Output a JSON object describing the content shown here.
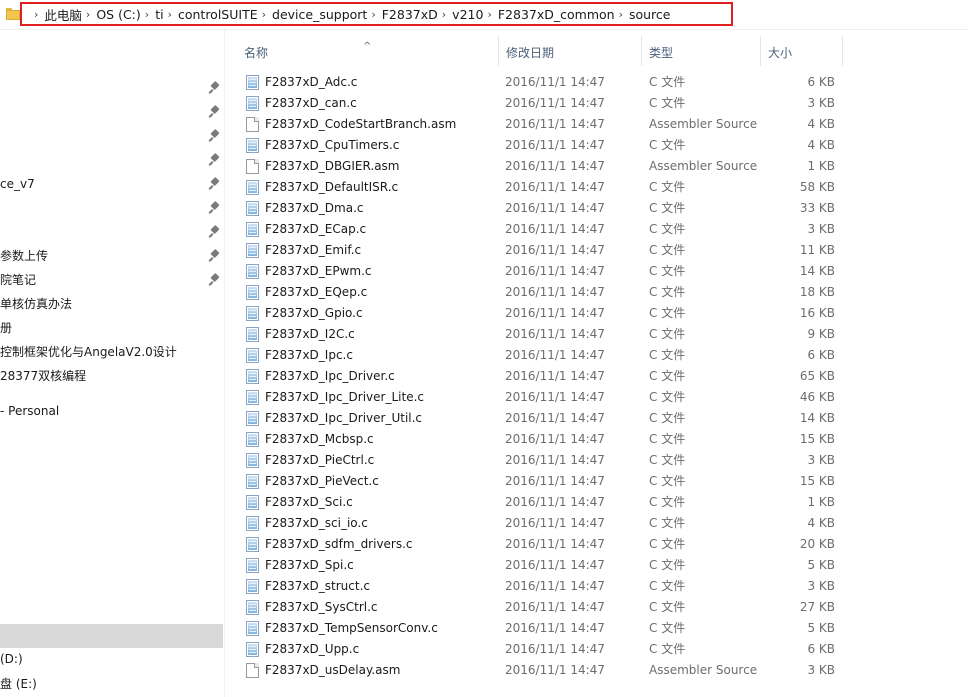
{
  "address": {
    "crumbs": [
      "此电脑",
      "OS (C:)",
      "ti",
      "controlSUITE",
      "device_support",
      "F2837xD",
      "v210",
      "F2837xD_common",
      "source"
    ],
    "separator": "›"
  },
  "nav": {
    "items": [
      {
        "label": "",
        "pinned": true
      },
      {
        "label": "",
        "pinned": true
      },
      {
        "label": "",
        "pinned": true
      },
      {
        "label": "",
        "pinned": true
      },
      {
        "label": "ce_v7",
        "pinned": true
      },
      {
        "label": "",
        "pinned": true
      },
      {
        "label": "",
        "pinned": true
      },
      {
        "label": "参数上传",
        "pinned": true
      },
      {
        "label": "院笔记",
        "pinned": true
      },
      {
        "label": "单核仿真办法",
        "pinned": false
      },
      {
        "label": "册",
        "pinned": false
      },
      {
        "label": "控制框架优化与AngelaV2.0设计",
        "pinned": false
      },
      {
        "label": "28377双核编程",
        "pinned": false
      }
    ],
    "onedrive": "- Personal",
    "drive_d": "(D:)",
    "drive_e": "盘 (E:)"
  },
  "columns": {
    "name": "名称",
    "date": "修改日期",
    "type": "类型",
    "size": "大小"
  },
  "files": [
    {
      "name": "F2837xD_Adc.c",
      "date": "2016/11/1 14:47",
      "type": "C 文件",
      "size": "6 KB",
      "icon": "c-file-icon"
    },
    {
      "name": "F2837xD_can.c",
      "date": "2016/11/1 14:47",
      "type": "C 文件",
      "size": "3 KB",
      "icon": "c-file-icon"
    },
    {
      "name": "F2837xD_CodeStartBranch.asm",
      "date": "2016/11/1 14:47",
      "type": "Assembler Source",
      "size": "4 KB",
      "icon": "asm-file-icon"
    },
    {
      "name": "F2837xD_CpuTimers.c",
      "date": "2016/11/1 14:47",
      "type": "C 文件",
      "size": "4 KB",
      "icon": "c-file-icon"
    },
    {
      "name": "F2837xD_DBGIER.asm",
      "date": "2016/11/1 14:47",
      "type": "Assembler Source",
      "size": "1 KB",
      "icon": "asm-file-icon"
    },
    {
      "name": "F2837xD_DefaultISR.c",
      "date": "2016/11/1 14:47",
      "type": "C 文件",
      "size": "58 KB",
      "icon": "c-file-icon"
    },
    {
      "name": "F2837xD_Dma.c",
      "date": "2016/11/1 14:47",
      "type": "C 文件",
      "size": "33 KB",
      "icon": "c-file-icon"
    },
    {
      "name": "F2837xD_ECap.c",
      "date": "2016/11/1 14:47",
      "type": "C 文件",
      "size": "3 KB",
      "icon": "c-file-icon"
    },
    {
      "name": "F2837xD_Emif.c",
      "date": "2016/11/1 14:47",
      "type": "C 文件",
      "size": "11 KB",
      "icon": "c-file-icon"
    },
    {
      "name": "F2837xD_EPwm.c",
      "date": "2016/11/1 14:47",
      "type": "C 文件",
      "size": "14 KB",
      "icon": "c-file-icon"
    },
    {
      "name": "F2837xD_EQep.c",
      "date": "2016/11/1 14:47",
      "type": "C 文件",
      "size": "18 KB",
      "icon": "c-file-icon"
    },
    {
      "name": "F2837xD_Gpio.c",
      "date": "2016/11/1 14:47",
      "type": "C 文件",
      "size": "16 KB",
      "icon": "c-file-icon"
    },
    {
      "name": "F2837xD_I2C.c",
      "date": "2016/11/1 14:47",
      "type": "C 文件",
      "size": "9 KB",
      "icon": "c-file-icon"
    },
    {
      "name": "F2837xD_Ipc.c",
      "date": "2016/11/1 14:47",
      "type": "C 文件",
      "size": "6 KB",
      "icon": "c-file-icon"
    },
    {
      "name": "F2837xD_Ipc_Driver.c",
      "date": "2016/11/1 14:47",
      "type": "C 文件",
      "size": "65 KB",
      "icon": "c-file-icon"
    },
    {
      "name": "F2837xD_Ipc_Driver_Lite.c",
      "date": "2016/11/1 14:47",
      "type": "C 文件",
      "size": "46 KB",
      "icon": "c-file-icon"
    },
    {
      "name": "F2837xD_Ipc_Driver_Util.c",
      "date": "2016/11/1 14:47",
      "type": "C 文件",
      "size": "14 KB",
      "icon": "c-file-icon"
    },
    {
      "name": "F2837xD_Mcbsp.c",
      "date": "2016/11/1 14:47",
      "type": "C 文件",
      "size": "15 KB",
      "icon": "c-file-icon"
    },
    {
      "name": "F2837xD_PieCtrl.c",
      "date": "2016/11/1 14:47",
      "type": "C 文件",
      "size": "3 KB",
      "icon": "c-file-icon"
    },
    {
      "name": "F2837xD_PieVect.c",
      "date": "2016/11/1 14:47",
      "type": "C 文件",
      "size": "15 KB",
      "icon": "c-file-icon"
    },
    {
      "name": "F2837xD_Sci.c",
      "date": "2016/11/1 14:47",
      "type": "C 文件",
      "size": "1 KB",
      "icon": "c-file-icon"
    },
    {
      "name": "F2837xD_sci_io.c",
      "date": "2016/11/1 14:47",
      "type": "C 文件",
      "size": "4 KB",
      "icon": "c-file-icon"
    },
    {
      "name": "F2837xD_sdfm_drivers.c",
      "date": "2016/11/1 14:47",
      "type": "C 文件",
      "size": "20 KB",
      "icon": "c-file-icon"
    },
    {
      "name": "F2837xD_Spi.c",
      "date": "2016/11/1 14:47",
      "type": "C 文件",
      "size": "5 KB",
      "icon": "c-file-icon"
    },
    {
      "name": "F2837xD_struct.c",
      "date": "2016/11/1 14:47",
      "type": "C 文件",
      "size": "3 KB",
      "icon": "c-file-icon"
    },
    {
      "name": "F2837xD_SysCtrl.c",
      "date": "2016/11/1 14:47",
      "type": "C 文件",
      "size": "27 KB",
      "icon": "c-file-icon"
    },
    {
      "name": "F2837xD_TempSensorConv.c",
      "date": "2016/11/1 14:47",
      "type": "C 文件",
      "size": "5 KB",
      "icon": "c-file-icon"
    },
    {
      "name": "F2837xD_Upp.c",
      "date": "2016/11/1 14:47",
      "type": "C 文件",
      "size": "6 KB",
      "icon": "c-file-icon"
    },
    {
      "name": "F2837xD_usDelay.asm",
      "date": "2016/11/1 14:47",
      "type": "Assembler Source",
      "size": "3 KB",
      "icon": "asm-file-icon"
    }
  ],
  "colors": {
    "highlight_border": "#e02020",
    "header_text": "#4c607a",
    "nav_selected": "#d9d9d9"
  }
}
